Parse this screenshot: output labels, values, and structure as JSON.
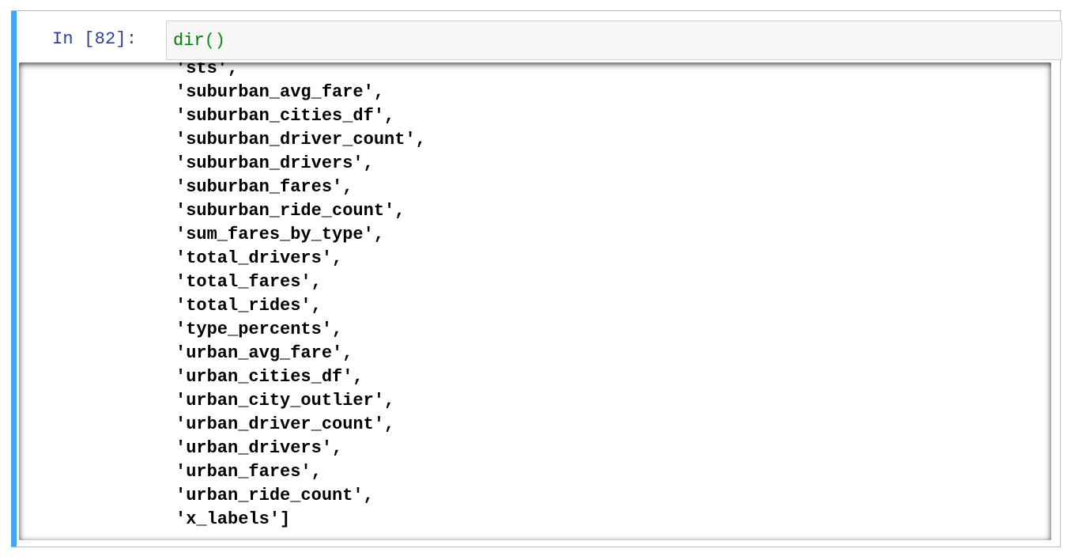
{
  "cell": {
    "prompt": "In [82]:",
    "code_function": "dir",
    "code_parens": "()",
    "colors": {
      "selected_bar": "#42a5f5",
      "prompt": "#303f9f",
      "function": "#008000"
    }
  },
  "output": {
    "lines": [
      "'sts',",
      "'suburban_avg_fare',",
      "'suburban_cities_df',",
      "'suburban_driver_count',",
      "'suburban_drivers',",
      "'suburban_fares',",
      "'suburban_ride_count',",
      "'sum_fares_by_type',",
      "'total_drivers',",
      "'total_fares',",
      "'total_rides',",
      "'type_percents',",
      "'urban_avg_fare',",
      "'urban_cities_df',",
      "'urban_city_outlier',",
      "'urban_driver_count',",
      "'urban_drivers',",
      "'urban_fares',",
      "'urban_ride_count',",
      "'x_labels']"
    ]
  }
}
